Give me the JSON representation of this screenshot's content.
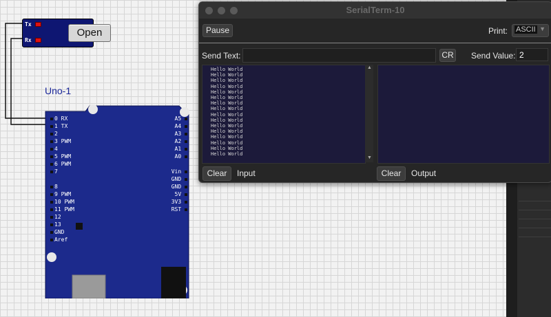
{
  "serial_component": {
    "tx_label": "Tx",
    "rx_label": "Rx",
    "open_button": "Open"
  },
  "board": {
    "name": "Uno-1",
    "left_pins": [
      "0 RX",
      "1 TX",
      "2",
      "3 PWM",
      "4",
      "5 PWM",
      "6 PWM",
      "7",
      "8",
      "9 PWM",
      "10 PWM",
      "11 PWM",
      "12",
      "13",
      "GND",
      "Aref"
    ],
    "right_pins_top": [
      "A5",
      "A4",
      "A3",
      "A2",
      "A1",
      "A0"
    ],
    "right_pins_bottom": [
      "Vin",
      "GND",
      "GND",
      "5V",
      "3V3",
      "RST"
    ]
  },
  "terminal": {
    "title": "SerialTerm-10",
    "pause_button": "Pause",
    "print_label": "Print:",
    "print_value": "ASCII",
    "send_text_label": "Send Text:",
    "send_text_value": "",
    "cr_button": "CR",
    "send_value_label": "Send Value:",
    "send_value": "2",
    "input_lines": [
      "Hello World",
      "Hello World",
      "Hello World",
      "Hello World",
      "Hello World",
      "Hello World",
      "Hello World",
      "Hello World",
      "Hello World",
      "Hello World",
      "Hello World",
      "Hello World",
      "Hello World",
      "Hello World",
      "Hello World",
      "Hello World"
    ],
    "input_clear_button": "Clear",
    "input_label": "Input",
    "output_clear_button": "Clear",
    "output_label": "Output"
  },
  "colors": {
    "board": "#1c2a8c",
    "serial_component": "#0e1672",
    "terminal_bg": "#1c1a3a",
    "led": "#e01010"
  }
}
